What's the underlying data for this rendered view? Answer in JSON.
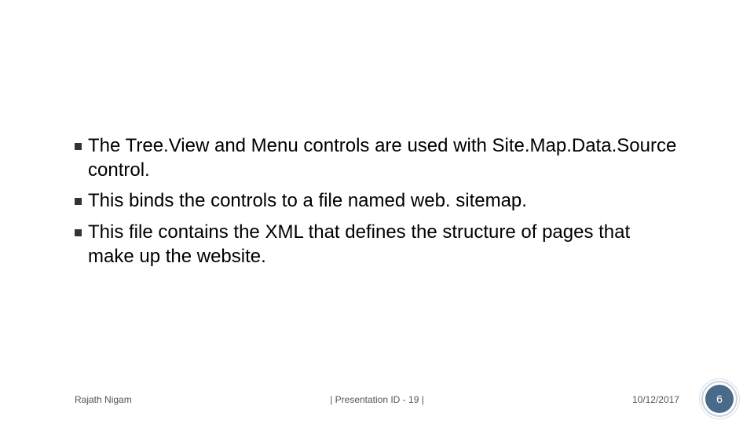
{
  "bullets": [
    "The Tree.View and Menu controls are used with Site.Map.Data.Source control.",
    "This binds the controls to a file named web. sitemap.",
    "This file contains the XML that defines the structure of pages that make up the website."
  ],
  "footer": {
    "author": "Rajath Nigam",
    "center": "| Presentation ID - 19 |",
    "date": "10/12/2017",
    "page": "6"
  }
}
